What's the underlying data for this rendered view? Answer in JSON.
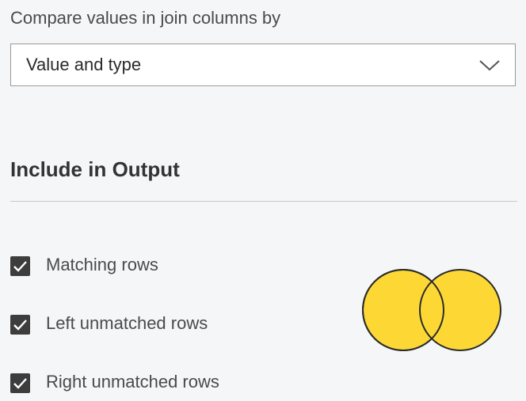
{
  "compare": {
    "label": "Compare values in join columns by",
    "selected": "Value and type",
    "dropdown_icon": "chevron-down-icon"
  },
  "output": {
    "heading": "Include in Output",
    "options": [
      {
        "label": "Matching rows",
        "checked": true
      },
      {
        "label": "Left unmatched rows",
        "checked": true
      },
      {
        "label": "Right unmatched rows",
        "checked": true
      }
    ]
  },
  "diagram": {
    "type": "venn-full-outer-join",
    "fill_color": "#fdd835",
    "stroke_color": "#2b2b2b"
  },
  "colors": {
    "background": "#f5f6f8",
    "checkbox": "#3d3d3d",
    "text": "#333333"
  }
}
